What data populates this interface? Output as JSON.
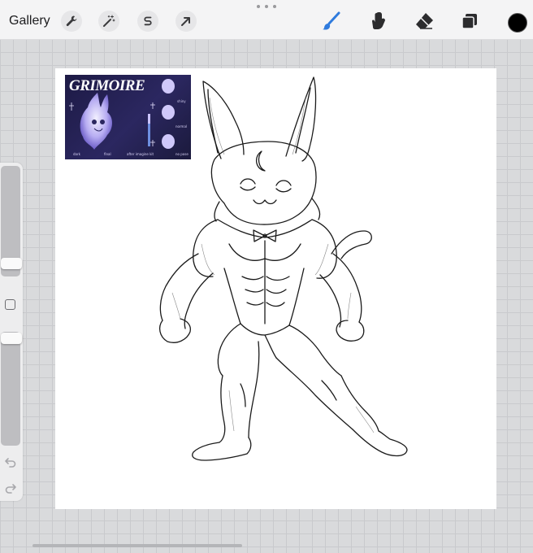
{
  "topbar": {
    "gallery_label": "Gallery",
    "left_tools": [
      "wrench-icon",
      "magic-wand-icon",
      "selection-s-icon",
      "transform-arrow-icon"
    ],
    "right_tools": [
      "brush-icon",
      "smudge-icon",
      "eraser-icon",
      "layers-icon"
    ],
    "active_tool": "brush-icon",
    "active_color": "#000000",
    "accent_color": "#2f7bdd"
  },
  "sidebar": {
    "brush_size_level": 0.88,
    "opacity_level": 0.05
  },
  "reference": {
    "title": "GRIMOIRE",
    "labels": [
      "dark",
      "final",
      "after imagine kit",
      "shiny",
      "normal",
      "no pose"
    ]
  }
}
